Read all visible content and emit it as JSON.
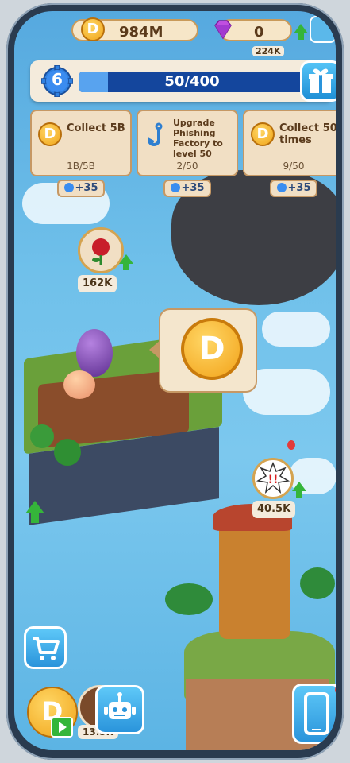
{
  "topbar": {
    "coins": "984M",
    "gems": "0",
    "partial_label": "224K"
  },
  "level": {
    "number": "6",
    "xp_text": "50/400",
    "progress": 0.125
  },
  "quests": [
    {
      "title": "Collect 5B",
      "progress": "1B/5B",
      "reward": "+35"
    },
    {
      "title": "Upgrade Phishing Factory to level 50",
      "progress": "2/50",
      "reward": "+35"
    },
    {
      "title": "Collect 50 times",
      "progress": "9/50",
      "reward": "+35"
    }
  ],
  "resources": {
    "rose_amount": "162K",
    "alert_amount": "40.5K",
    "bottom_amount": "13.5K"
  },
  "icons": {
    "coin_letter": "D"
  },
  "colors": {
    "sky": "#6fc0ea",
    "panel": "#f1dfc4",
    "xp_bar": "#14469d",
    "accent_green": "#35b53a"
  }
}
